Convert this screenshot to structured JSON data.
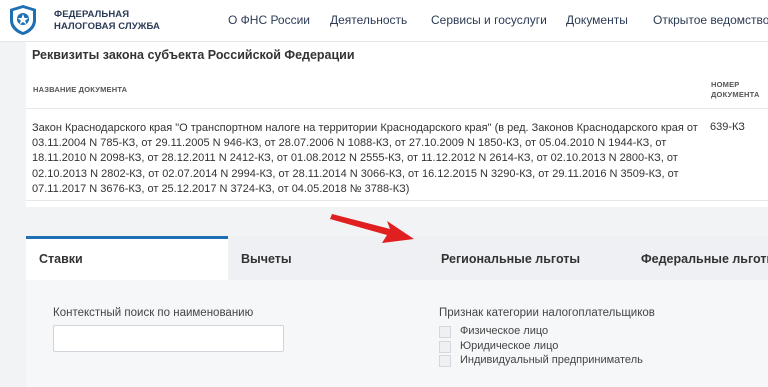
{
  "header": {
    "brand_line1": "ФЕДЕРАЛЬНАЯ",
    "brand_line2": "НАЛОГОВАЯ СЛУЖБА",
    "nav": [
      "О ФНС России",
      "Деятельность",
      "Сервисы и госуслуги",
      "Документы",
      "Открытое ведомство"
    ]
  },
  "card": {
    "title": "Реквизиты закона субъекта Российской Федерации",
    "col_name": "НАЗВАНИЕ ДОКУМЕНТА",
    "col_number_line1": "НОМЕР",
    "col_number_line2": "ДОКУМЕНТА",
    "document_text": "Закон Краснодарского края \"О транспортном налоге на территории Краснодарского края\" (в ред. Законов Краснодарского края от 03.11.2004 N 785-КЗ, от 29.11.2005 N 946-КЗ, от 28.07.2006 N 1088-КЗ, от 27.10.2009 N 1850-КЗ, от 05.04.2010 N 1944-КЗ, от 18.11.2010 N 2098-КЗ, от 28.12.2011 N 2412-КЗ, от 01.08.2012 N 2555-КЗ, от 11.12.2012 N 2614-КЗ, от 02.10.2013 N 2800-КЗ, от 02.10.2013 N 2802-КЗ, от 02.07.2014 N 2994-КЗ, от 28.11.2014 N 3066-КЗ, от 16.12.2015 N 3290-КЗ, от 29.11.2016 N 3509-КЗ, от 07.11.2017 N 3676-КЗ, от 25.12.2017 N 3724-КЗ, от 04.05.2018 № 3788-КЗ)",
    "document_number": "639-КЗ"
  },
  "tabs": [
    {
      "label": "Ставки",
      "active": true
    },
    {
      "label": "Вычеты",
      "active": false
    },
    {
      "label": "Региональные льготы",
      "active": false
    },
    {
      "label": "Федеральные льготы",
      "active": false
    }
  ],
  "panel": {
    "search_label": "Контекстный поиск по наименованию",
    "search_value": "",
    "category_label": "Признак категории налогоплательщиков",
    "checkboxes": [
      "Физическое лицо",
      "Юридическое лицо",
      "Индивидуальный предприниматель"
    ]
  },
  "colors": {
    "accent": "#1f6fb5",
    "arrow": "#e02020",
    "brand_text": "#2b3b55"
  }
}
